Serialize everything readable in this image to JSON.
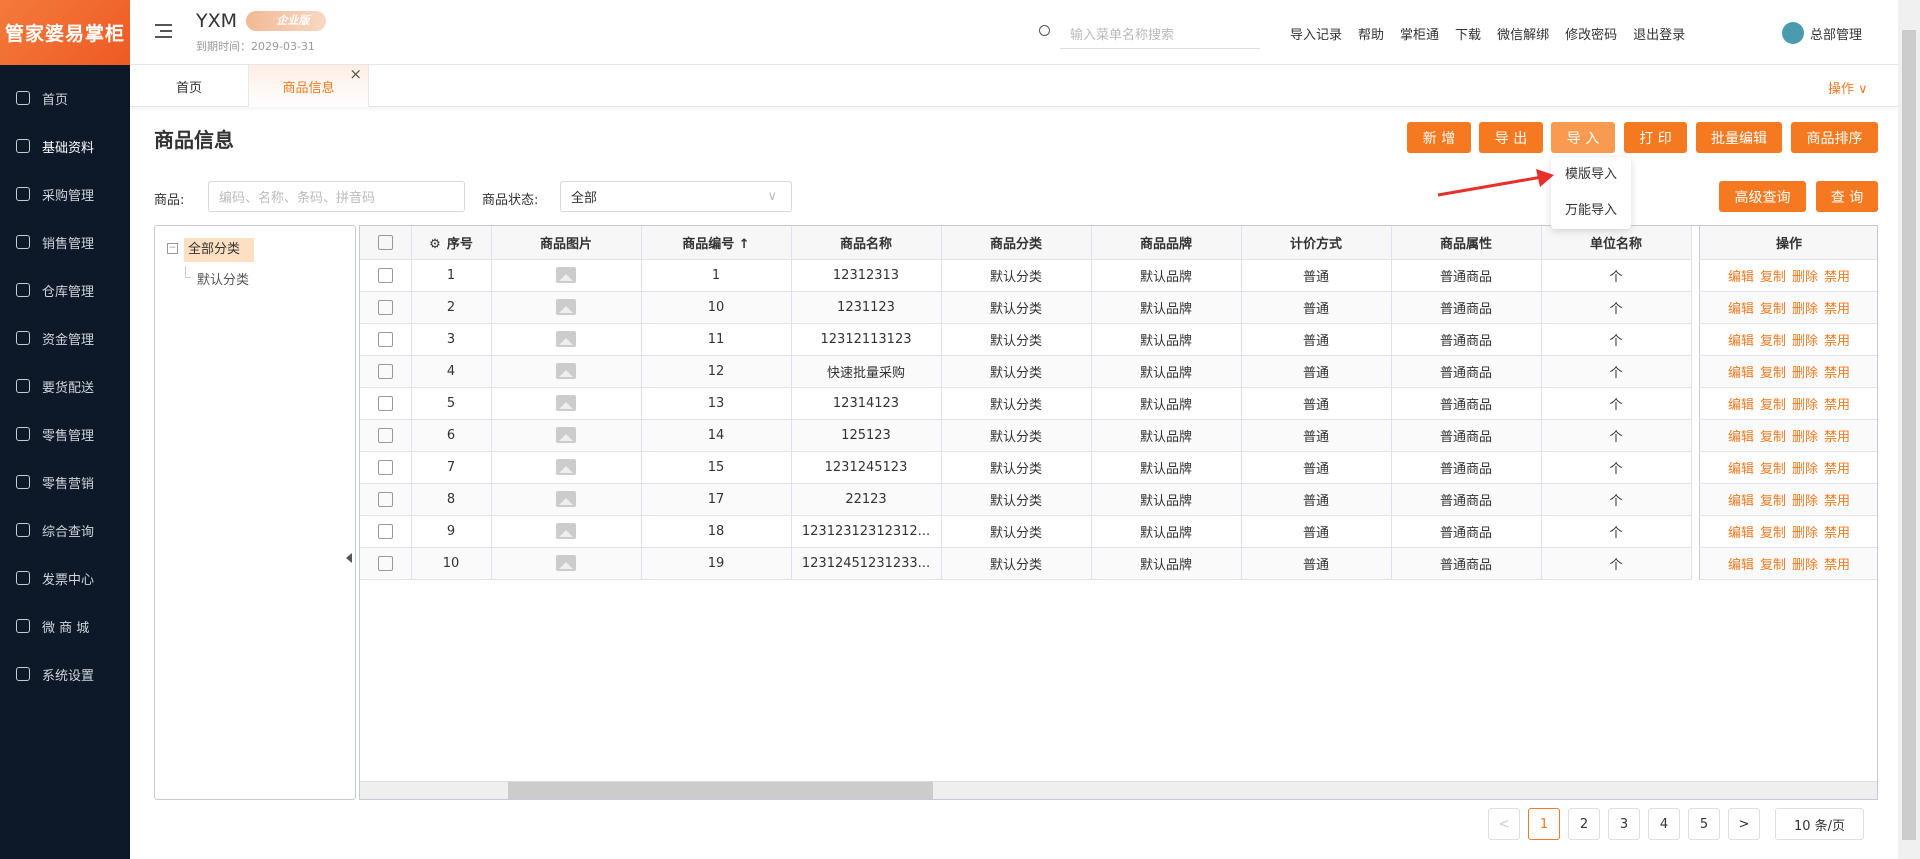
{
  "logo": "管家婆易掌柜",
  "sidebar": {
    "items": [
      {
        "label": "首页",
        "icon": "globe-icon"
      },
      {
        "label": "基础资料",
        "icon": "home-icon"
      },
      {
        "label": "采购管理",
        "icon": "cart-icon"
      },
      {
        "label": "销售管理",
        "icon": "sales-icon"
      },
      {
        "label": "仓库管理",
        "icon": "warehouse-icon"
      },
      {
        "label": "资金管理",
        "icon": "money-icon"
      },
      {
        "label": "要货配送",
        "icon": "delivery-icon"
      },
      {
        "label": "零售管理",
        "icon": "chart-icon"
      },
      {
        "label": "零售营销",
        "icon": "gift-icon"
      },
      {
        "label": "综合查询",
        "icon": "bar-chart-icon"
      },
      {
        "label": "发票中心",
        "icon": "invoice-icon"
      },
      {
        "label": "微 商 城",
        "icon": "shop-icon"
      },
      {
        "label": "系统设置",
        "icon": "gear-icon"
      }
    ]
  },
  "header": {
    "company": "YXM",
    "badge": "企业版",
    "expire": "到期时间：2029-03-31",
    "search_placeholder": "输入菜单名称搜索",
    "links": [
      "导入记录",
      "帮助",
      "掌柜通",
      "下载",
      "微信解绑",
      "修改密码",
      "退出登录"
    ],
    "user": "总部管理"
  },
  "tabs": {
    "items": [
      "首页",
      "商品信息"
    ],
    "close": "×",
    "ops": "操作 ∨"
  },
  "page": {
    "title": "商品信息",
    "buttons": [
      "新 增",
      "导 出",
      "导 入",
      "打 印",
      "批量编辑",
      "商品排序"
    ],
    "dropdown": [
      "模版导入",
      "万能导入"
    ],
    "filter": {
      "goods_label": "商品:",
      "goods_placeholder": "编码、名称、条码、拼音码",
      "status_label": "商品状态:",
      "status_value": "全部"
    },
    "adv_search": "高级查询",
    "search": "查 询"
  },
  "tree": {
    "root": "全部分类",
    "child": "默认分类"
  },
  "table": {
    "headers": [
      "序号",
      "商品图片",
      "商品编号 ↑",
      "商品名称",
      "商品分类",
      "商品品牌",
      "计价方式",
      "商品属性",
      "单位名称",
      "操作"
    ],
    "rows": [
      [
        "1",
        "1",
        "12312313"
      ],
      [
        "2",
        "10",
        "1231123"
      ],
      [
        "3",
        "11",
        "12312113123"
      ],
      [
        "4",
        "12",
        "快速批量采购"
      ],
      [
        "5",
        "13",
        "12314123"
      ],
      [
        "6",
        "14",
        "125123"
      ],
      [
        "7",
        "15",
        "1231245123"
      ],
      [
        "8",
        "17",
        "22123"
      ],
      [
        "9",
        "18",
        "12312312312312..."
      ],
      [
        "10",
        "19",
        "12312451231233..."
      ]
    ],
    "category": "默认分类",
    "brand": "默认品牌",
    "pricing": "普通",
    "attr": "普通商品",
    "unit": "个",
    "ops": [
      "编辑",
      "复制",
      "删除",
      "禁用"
    ]
  },
  "pagination": {
    "prev": "<",
    "pages": [
      "1",
      "2",
      "3",
      "4",
      "5"
    ],
    "current": "1",
    "next": ">",
    "size": "10 条/页"
  },
  "colors": {
    "accent": "#f47920",
    "sidebar": "#0d1828"
  }
}
